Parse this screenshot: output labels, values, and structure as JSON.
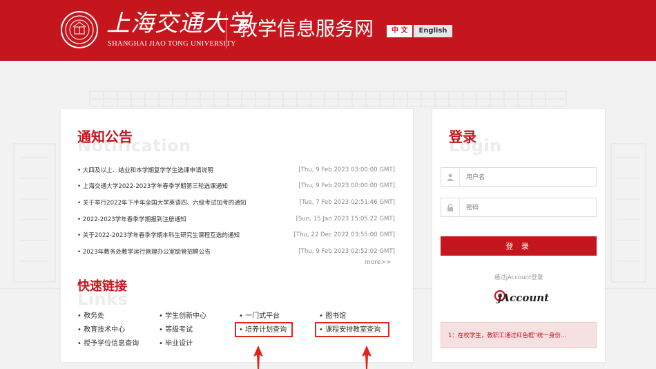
{
  "header": {
    "university_cn": "上海交通大学",
    "university_en": "Shanghai Jiao Tong University",
    "system_title": "教学信息服务网",
    "lang_zh": "中 文",
    "lang_en": "English"
  },
  "notice": {
    "title": "通知公告",
    "title_bg": "Notification",
    "items": [
      {
        "text": "• 大四及以上、结业和本学期复学学生选课申请说明",
        "date": "[Thu, 9 Feb 2023 03:00:00 GMT]"
      },
      {
        "text": "• 上海交通大学2022-2023学年春季学期第三轮选课通知",
        "date": "[Thu, 9 Feb 2023 00:00:00 GMT]"
      },
      {
        "text": "• 关于举行2022年下半年全国大学英语四、六级考试加考的通知",
        "date": "[Tue, 7 Feb 2023 02:51:46 GMT]"
      },
      {
        "text": "• 2022-2023学年春季学期报到注册通知",
        "date": "[Sun, 15 Jan 2023 15:05:22 GMT]"
      },
      {
        "text": "• 关于2022-2023学年春季学期本科生研究生课程互选的通知",
        "date": "[Thu, 22 Dec 2022 03:55:00 GMT]"
      },
      {
        "text": "• 2023年教务处教学运行管理办公室助管招聘公告",
        "date": "[Thu, 9 Feb 2023 02:52:02 GMT]"
      }
    ],
    "more": "more>>"
  },
  "links": {
    "title": "快速链接",
    "title_bg": "Links",
    "items": [
      "• 教务处",
      "• 学生创新中心",
      "• 一门式平台",
      "• 图书馆",
      "• 教育技术中心",
      "• 等级考试",
      "• 培养计划查询",
      "• 课程安排教室查询",
      "• 授予学位信息查询",
      "• 毕业设计"
    ]
  },
  "login": {
    "title": "登录",
    "title_bg": "Login",
    "username_placeholder": "用户名",
    "password_placeholder": "密码",
    "button": "登 录",
    "jaccount_label": "通过jAccount登录",
    "jaccount_logo": "jAccount",
    "tip": "1：在校学生，教职工通过红色框“统一身份..."
  },
  "colors": {
    "brand_red": "#c5161d",
    "annotation_red": "#e3231a"
  }
}
